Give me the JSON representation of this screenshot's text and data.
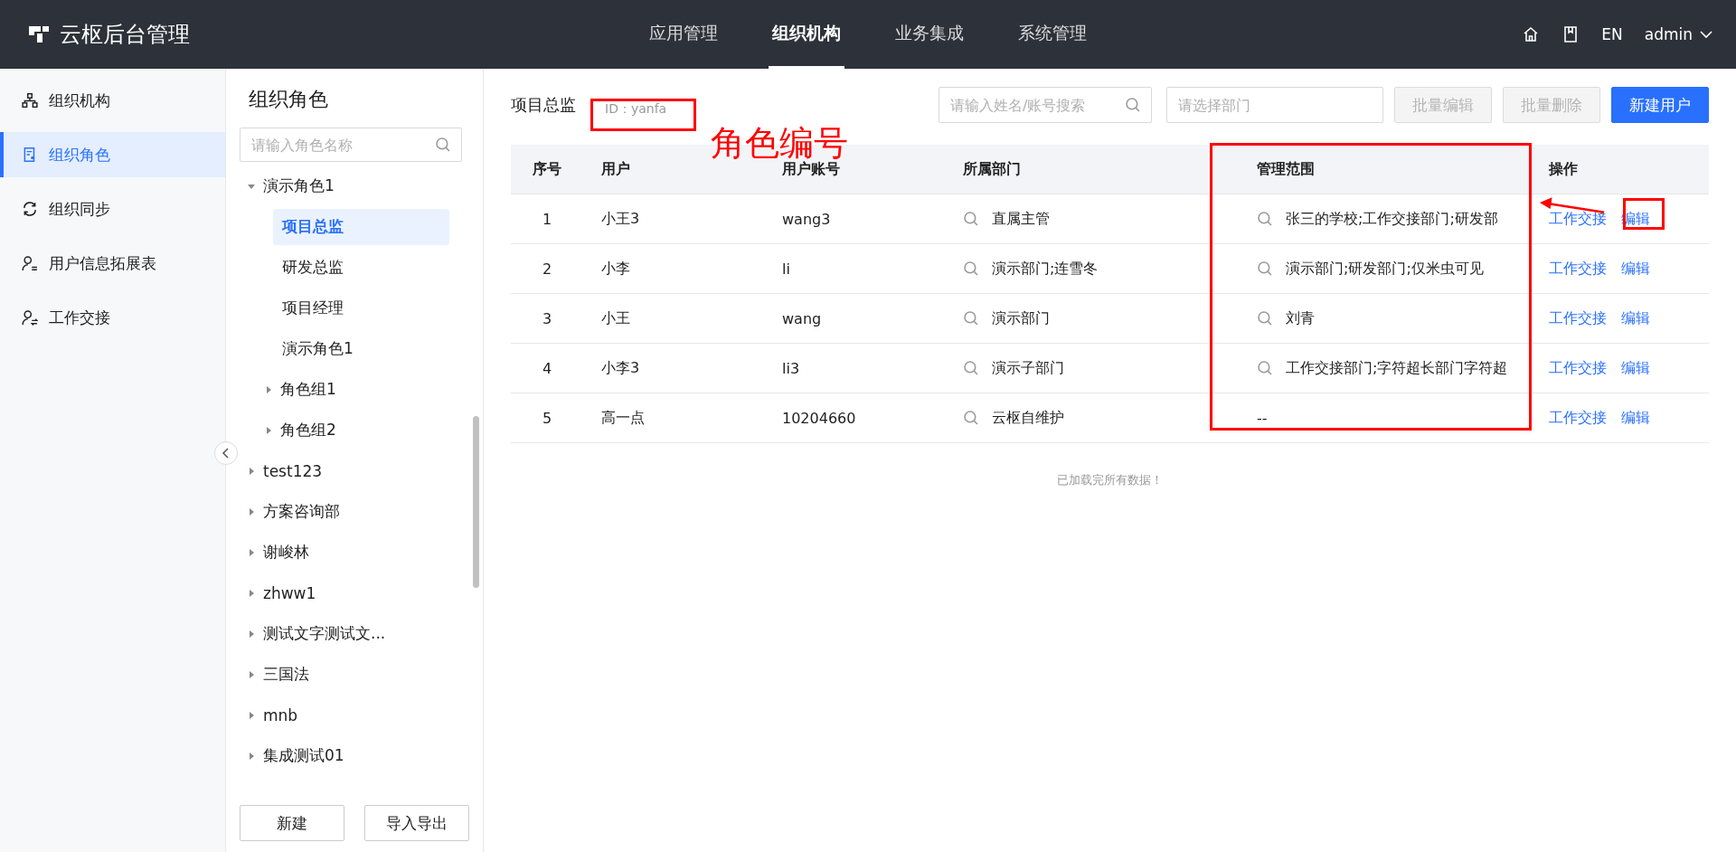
{
  "header": {
    "logo_text": "云枢后台管理",
    "nav": [
      {
        "label": "应用管理",
        "selected": false
      },
      {
        "label": "组织机构",
        "selected": true
      },
      {
        "label": "业务集成",
        "selected": false
      },
      {
        "label": "系统管理",
        "selected": false
      }
    ],
    "language": "EN",
    "user": "admin"
  },
  "sidebar": {
    "items": [
      {
        "label": "组织机构",
        "kind": "org",
        "selected": false
      },
      {
        "label": "组织角色",
        "kind": "role",
        "selected": true
      },
      {
        "label": "组织同步",
        "kind": "sync",
        "selected": false
      },
      {
        "label": "用户信息拓展表",
        "kind": "user-info",
        "selected": false
      },
      {
        "label": "工作交接",
        "kind": "handover",
        "selected": false
      }
    ]
  },
  "role_panel": {
    "title": "组织角色",
    "search": {
      "placeholder": "请输入角色名称"
    },
    "tree": [
      {
        "label": "演示角色1",
        "expanded": true,
        "children": [
          {
            "label": "项目总监",
            "selected": true
          },
          {
            "label": "研发总监",
            "selected": false
          },
          {
            "label": "项目经理",
            "selected": false
          },
          {
            "label": "演示角色1",
            "selected": false
          },
          {
            "label": "角色组1",
            "expanded": false
          },
          {
            "label": "角色组2",
            "expanded": false
          }
        ]
      },
      {
        "label": "test123",
        "expanded": false
      },
      {
        "label": "方案咨询部",
        "expanded": false
      },
      {
        "label": "谢峻林",
        "expanded": false
      },
      {
        "label": "zhww1",
        "expanded": false
      },
      {
        "label": "测试文字测试文...",
        "expanded": false
      },
      {
        "label": "三国法",
        "expanded": false
      },
      {
        "label": "mnb",
        "expanded": false
      },
      {
        "label": "集成测试01",
        "expanded": false
      }
    ],
    "buttons": [
      "新建",
      "导入导出"
    ]
  },
  "main": {
    "role_title": "项目总监",
    "role_id": "ID：yanfa",
    "search": {
      "placeholder": "请输入姓名/账号搜索"
    },
    "department_select": {
      "placeholder": "请选择部门"
    },
    "actions": [
      {
        "label": "批量编辑",
        "disabled": true
      },
      {
        "label": "批量删除",
        "disabled": true
      },
      {
        "label": "新建用户",
        "disabled": false
      }
    ],
    "table": {
      "columns": [
        "序号",
        "用户",
        "用户账号",
        "所属部门",
        "管理范围",
        "操作"
      ],
      "rows": [
        {
          "index": "1",
          "user": "小王3",
          "account": "wang3",
          "department": {
            "kind": "lookup",
            "text": "直属主管"
          },
          "scope": {
            "kind": "lookup",
            "text": "张三的学校;工作交接部门;研发部"
          },
          "actions": [
            "工作交接",
            "编辑"
          ]
        },
        {
          "index": "2",
          "user": "小李",
          "account": "li",
          "department": {
            "kind": "lookup",
            "text": "演示部门;连雪冬"
          },
          "scope": {
            "kind": "lookup",
            "text": "演示部门;研发部门;仅米虫可见"
          },
          "actions": [
            "工作交接",
            "编辑"
          ]
        },
        {
          "index": "3",
          "user": "小王",
          "account": "wang",
          "department": {
            "kind": "lookup",
            "text": "演示部门"
          },
          "scope": {
            "kind": "lookup",
            "text": "刘青"
          },
          "actions": [
            "工作交接",
            "编辑"
          ]
        },
        {
          "index": "4",
          "user": "小李3",
          "account": "li3",
          "department": {
            "kind": "lookup",
            "text": "演示子部门"
          },
          "scope": {
            "kind": "lookup",
            "text": "工作交接部门;字符超长部门字符超"
          },
          "actions": [
            "工作交接",
            "编辑"
          ]
        },
        {
          "index": "5",
          "user": "高一点",
          "account": "10204660",
          "department": {
            "kind": "lookup",
            "text": "云枢自维护"
          },
          "scope": {
            "kind": "text",
            "text": "--"
          },
          "actions": [
            "工作交接",
            "编辑"
          ]
        }
      ]
    },
    "footer_note": "已加载完所有数据！"
  },
  "annotation": {
    "label": "角色编号"
  }
}
